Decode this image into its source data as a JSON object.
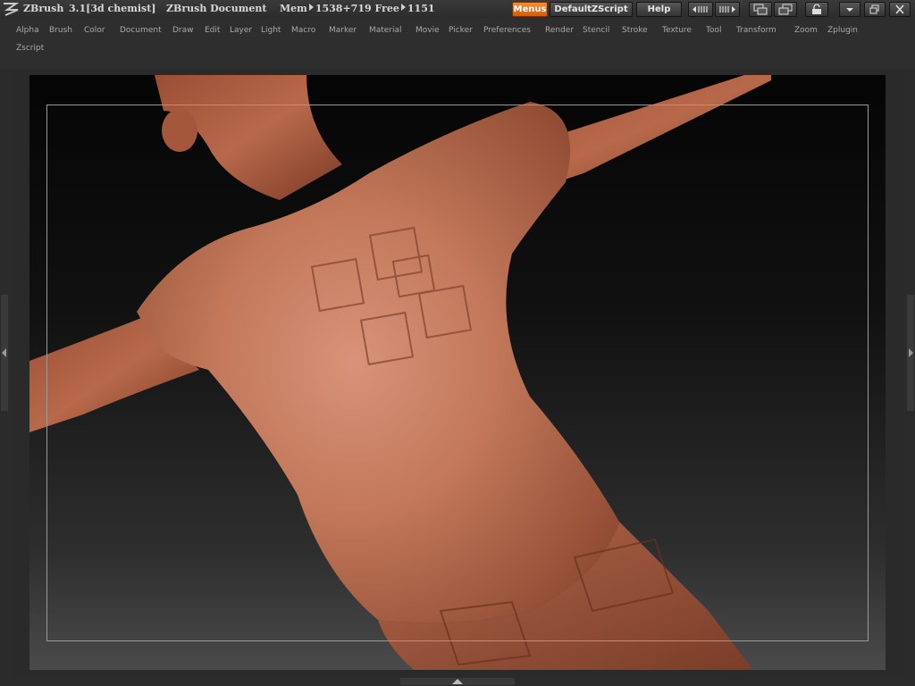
{
  "title_bar": {
    "app_name": "ZBrush",
    "version": "3.1[3d chemist]",
    "document": "ZBrush Document",
    "mem_label": "Mem",
    "mem_value": "1538+719",
    "free_label": "Free",
    "free_value": "1151",
    "menus_button": "Menus",
    "script_button": "DefaultZScript",
    "help_button": "Help",
    "accent_color": "#f07a10"
  },
  "menus": {
    "row1": [
      "Alpha",
      "Brush",
      "Color",
      "Document",
      "Draw",
      "Edit",
      "Layer",
      "Light",
      "Macro",
      "Marker",
      "Material",
      "Movie",
      "Picker",
      "Preferences",
      "Render",
      "Stencil",
      "Stroke",
      "Texture",
      "Tool",
      "Transform",
      "Zoom",
      "Zplugin"
    ],
    "row2": [
      "Zscript"
    ]
  },
  "icons": [
    "zbrush-logo-icon",
    "tray-left-icon",
    "tray-right-icon",
    "layout-icon",
    "layout-alt-icon",
    "lock-icon",
    "minimize-icon",
    "restore-icon",
    "close-icon"
  ],
  "canvas": {
    "subject": "3D sculpt of figure from behind wearing t-shirt and jeans",
    "model_color": "#b86a4c"
  }
}
